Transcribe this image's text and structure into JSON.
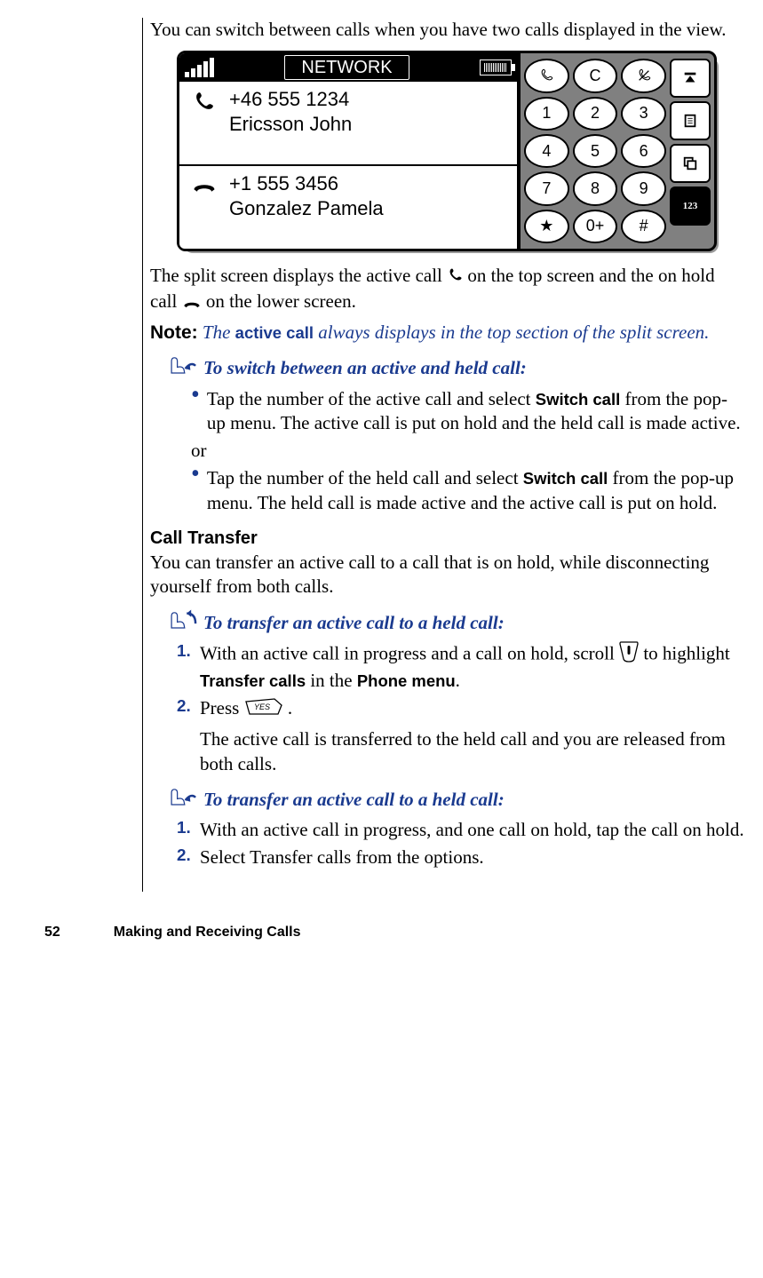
{
  "intro": "You can switch between calls when you have two calls displayed in the view.",
  "phone": {
    "network": "NETWORK",
    "active": {
      "number": "+46 555 1234",
      "name": "Ericsson John"
    },
    "held": {
      "number": "+1 555 3456",
      "name": "Gonzalez Pamela"
    },
    "keys": {
      "c": "C",
      "k1": "1",
      "k2": "2",
      "k3": "3",
      "k4": "4",
      "k5": "5",
      "k6": "6",
      "k7": "7",
      "k8": "8",
      "k9": "9",
      "star": "★",
      "k0": "0+",
      "hash": "#"
    },
    "side123": "123"
  },
  "split_desc_1": "The split screen displays the active call ",
  "split_desc_2": " on the top screen and the on hold call ",
  "split_desc_3": " on the lower screen.",
  "note_label": "Note:",
  "note_1": "The ",
  "note_term": "active call",
  "note_2": " always displays in the top section of the split screen.",
  "proc1_title": "To switch between an active and held call:",
  "proc1_b1a": "Tap the number of the active call and select ",
  "proc1_b1_term": "Switch call",
  "proc1_b1b": " from the pop-up menu. The active call is put on hold and the held call is made active.",
  "or": "or",
  "proc1_b2a": "Tap the number of the held call and select ",
  "proc1_b2_term": "Switch call",
  "proc1_b2b": " from the pop-up menu. The held call is made active and the active call is put on hold.",
  "transfer_head": "Call Transfer",
  "transfer_intro": "You can transfer an active call to a call that is on hold, while disconnecting yourself from both calls.",
  "proc2_title": "To transfer an active call to a held call:",
  "proc2_s1a": "With an active call in progress and a call on hold, scroll ",
  "proc2_s1b": " to highlight ",
  "proc2_s1_term1": "Transfer calls",
  "proc2_s1c": " in the ",
  "proc2_s1_term2": "Phone menu",
  "proc2_s1d": ".",
  "proc2_s2a": "Press ",
  "proc2_s2b": ".",
  "proc2_result": "The active call is transferred to the held call and you are released from both calls.",
  "proc3_title": "To transfer an active call to a held call:",
  "proc3_s1": "With an active call in progress, and one call on hold, tap the call on hold.",
  "proc3_s2": "Select Transfer calls from the options.",
  "num1": "1.",
  "num2": "2.",
  "yes_label": "YES",
  "footer_page": "52",
  "footer_title": "Making and Receiving Calls"
}
